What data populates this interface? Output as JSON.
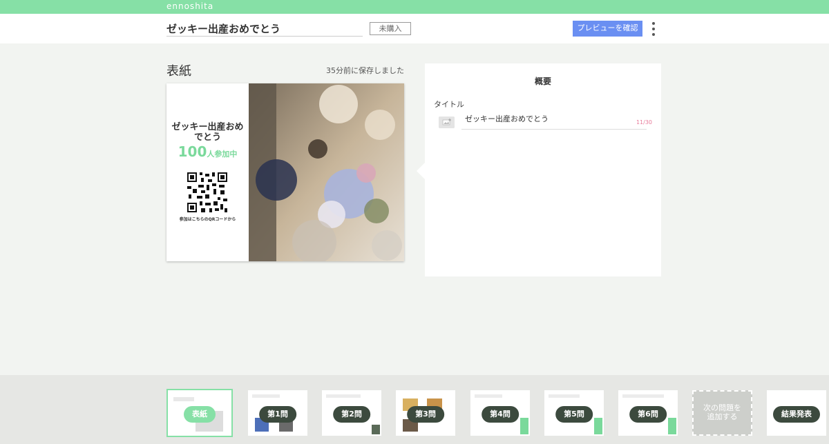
{
  "app": {
    "brand": "ennoshita"
  },
  "header": {
    "survey_title": "ゼッキー出産おめでとう",
    "status_badge": "未購入",
    "preview_button": "プレビューを確認",
    "more_icon": "more-vertical-icon"
  },
  "cover": {
    "heading": "表紙",
    "saved_status": "35分前に保存しました",
    "card_title": "ゼッキー出産おめでとう",
    "participants_count": "100",
    "participants_suffix": "人参加中",
    "qr_caption": "参加はこちらのQRコードから"
  },
  "overview": {
    "title": "概要",
    "title_field_label": "タイトル",
    "title_value": "ゼッキー出産おめでとう",
    "char_count": "11/30",
    "image_icon": "image-add-icon"
  },
  "slides": [
    {
      "label": "表紙",
      "active": true
    },
    {
      "label": "第1問",
      "active": false
    },
    {
      "label": "第2問",
      "active": false
    },
    {
      "label": "第3問",
      "active": false
    },
    {
      "label": "第4問",
      "active": false
    },
    {
      "label": "第5問",
      "active": false
    },
    {
      "label": "第6問",
      "active": false
    }
  ],
  "add_question": {
    "label_line1": "次の問題を",
    "label_line2": "追加する"
  },
  "results": {
    "label": "結果発表"
  },
  "colors": {
    "accent_green": "#86e0a6",
    "primary_blue": "#6a8ff2",
    "dark_pill": "#3c4a3e",
    "count_pink": "#e87a9a"
  }
}
